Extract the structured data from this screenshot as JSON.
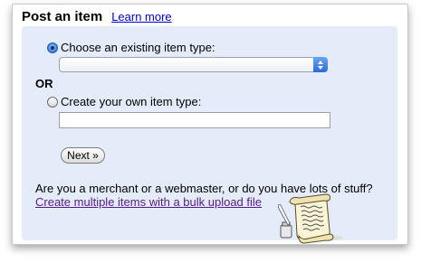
{
  "header": {
    "title": "Post an item",
    "learn_more": "Learn more"
  },
  "existing_type": {
    "label": "Choose an existing item type:",
    "selected_value": "",
    "checked": true
  },
  "separator": "OR",
  "own_type": {
    "label": "Create your own item type:",
    "value": "",
    "checked": false
  },
  "next_button": "Next »",
  "bulk": {
    "question": "Are you a merchant or a webmaster, or do you have lots of stuff?",
    "link": "Create multiple items with a bulk upload file"
  },
  "colors": {
    "panel_background": "#e5ecf9",
    "link": "#0000cc",
    "visited_link": "#551a8b",
    "select_arrow": "#3a7be0"
  },
  "icons": {
    "select_arrow": "up-down-arrows-icon",
    "illustration": "scroll-illustration"
  }
}
